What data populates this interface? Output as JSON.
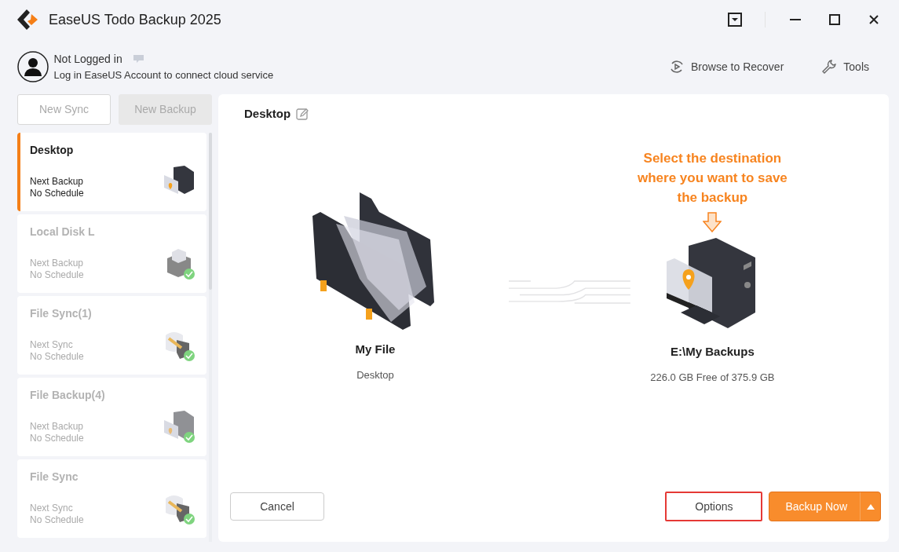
{
  "window": {
    "title": "EaseUS Todo Backup 2025"
  },
  "account": {
    "status": "Not Logged in",
    "message": "Log in EaseUS Account to connect cloud service"
  },
  "toolbar": [
    {
      "label": "Browse to Recover",
      "kind": "recover"
    },
    {
      "label": "Tools",
      "kind": "tools"
    }
  ],
  "new_buttons": [
    {
      "label": "New Sync",
      "kind": "outline"
    },
    {
      "label": "New Backup",
      "kind": "filled"
    }
  ],
  "tasks": [
    {
      "name": "Desktop",
      "next_label": "Next Backup",
      "schedule": "No Schedule",
      "selected": true,
      "kind": "computer",
      "done": false
    },
    {
      "name": "Local Disk L",
      "next_label": "Next Backup",
      "schedule": "No Schedule",
      "selected": false,
      "kind": "disk",
      "done": true
    },
    {
      "name": "File Sync(1)",
      "next_label": "Next Sync",
      "schedule": "No Schedule",
      "selected": false,
      "kind": "sync",
      "done": true
    },
    {
      "name": "File Backup(4)",
      "next_label": "Next Backup",
      "schedule": "No Schedule",
      "selected": false,
      "kind": "computer",
      "done": true
    },
    {
      "name": "File Sync",
      "next_label": "Next Sync",
      "schedule": "No Schedule",
      "selected": false,
      "kind": "sync",
      "done": true
    }
  ],
  "task": {
    "title": "Desktop",
    "source": {
      "name": "My File",
      "detail": "Desktop"
    },
    "hint": "Select the destination where you want to save the backup",
    "destination": {
      "name": "E:\\My Backups",
      "detail": "226.0 GB Free of 375.9 GB"
    }
  },
  "actions": {
    "cancel": "Cancel",
    "options": {
      "label": "Options",
      "highlighted": true
    },
    "backup": "Backup Now"
  }
}
